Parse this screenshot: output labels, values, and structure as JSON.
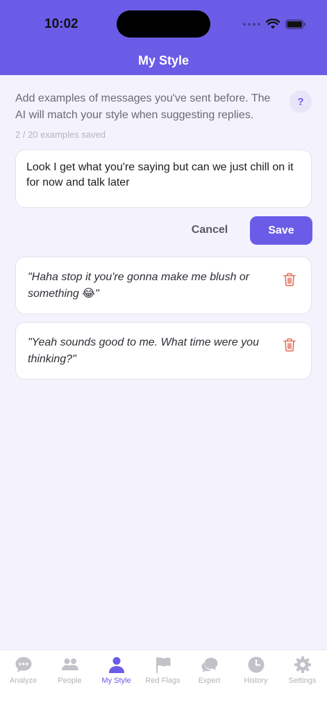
{
  "status_bar": {
    "time": "10:02"
  },
  "header": {
    "title": "My Style"
  },
  "intro": {
    "text": "Add examples of messages you've sent before. The AI will match your style when suggesting replies.",
    "help_label": "?"
  },
  "saved_count": "2 / 20 examples saved",
  "composer": {
    "value": "Look I get what you're saying but can we just chill on it for now and talk later"
  },
  "actions": {
    "cancel_label": "Cancel",
    "save_label": "Save"
  },
  "examples": [
    {
      "text": "\"Haha stop it you're gonna make me blush or something 😂\""
    },
    {
      "text": "\"Yeah sounds good to me. What time were you thinking?\""
    }
  ],
  "tabs": [
    {
      "label": "Analyze",
      "icon": "chat-bubble-icon"
    },
    {
      "label": "People",
      "icon": "people-icon"
    },
    {
      "label": "My Style",
      "icon": "person-icon",
      "active": true
    },
    {
      "label": "Red Flags",
      "icon": "flag-icon"
    },
    {
      "label": "Expert",
      "icon": "speech-bubbles-icon"
    },
    {
      "label": "History",
      "icon": "clock-icon"
    },
    {
      "label": "Settings",
      "icon": "gear-icon"
    }
  ],
  "colors": {
    "accent": "#6b5ce7",
    "background": "#f4f2fd",
    "danger": "#e2705a",
    "inactive": "#b3b3bb"
  }
}
